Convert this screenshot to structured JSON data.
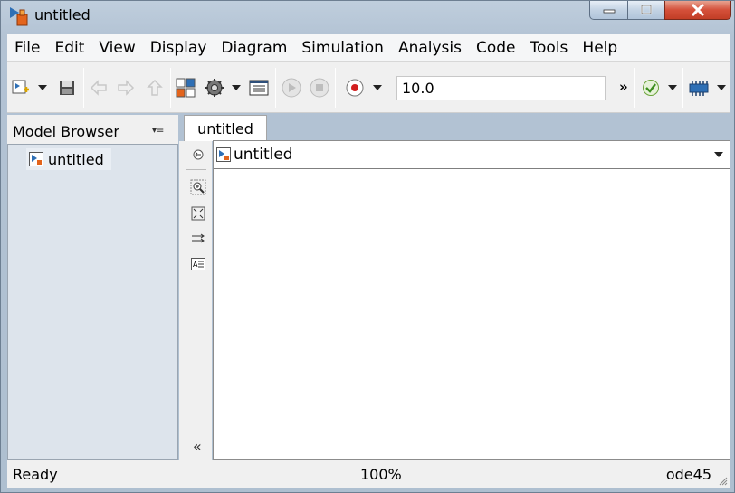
{
  "window": {
    "title": "untitled"
  },
  "menu": [
    "File",
    "Edit",
    "View",
    "Display",
    "Diagram",
    "Simulation",
    "Analysis",
    "Code",
    "Tools",
    "Help"
  ],
  "toolbar": {
    "stop_time": "10.0",
    "overflow": "»"
  },
  "browser": {
    "title": "Model Browser",
    "menu_glyph": "▾≡",
    "root_label": "untitled"
  },
  "editor": {
    "tab_label": "untitled",
    "address": "untitled",
    "collapse_glyph": "«"
  },
  "status": {
    "state": "Ready",
    "zoom": "100%",
    "solver": "ode45"
  },
  "colors": {
    "title_bar": "#b3c3d4",
    "close_button": "#d4503a",
    "browser_bg": "#dde4ec",
    "canvas_bg": "#ffffff"
  },
  "icons": [
    "new-model-icon",
    "save-icon",
    "back-icon",
    "forward-icon",
    "up-icon",
    "library-browser-icon",
    "model-settings-icon",
    "explorer-icon",
    "run-icon",
    "stop-icon",
    "record-icon",
    "check-icon",
    "hardware-icon",
    "nav-up-icon",
    "zoom-icon",
    "fit-view-icon",
    "signal-routing-icon",
    "annotation-icon"
  ]
}
